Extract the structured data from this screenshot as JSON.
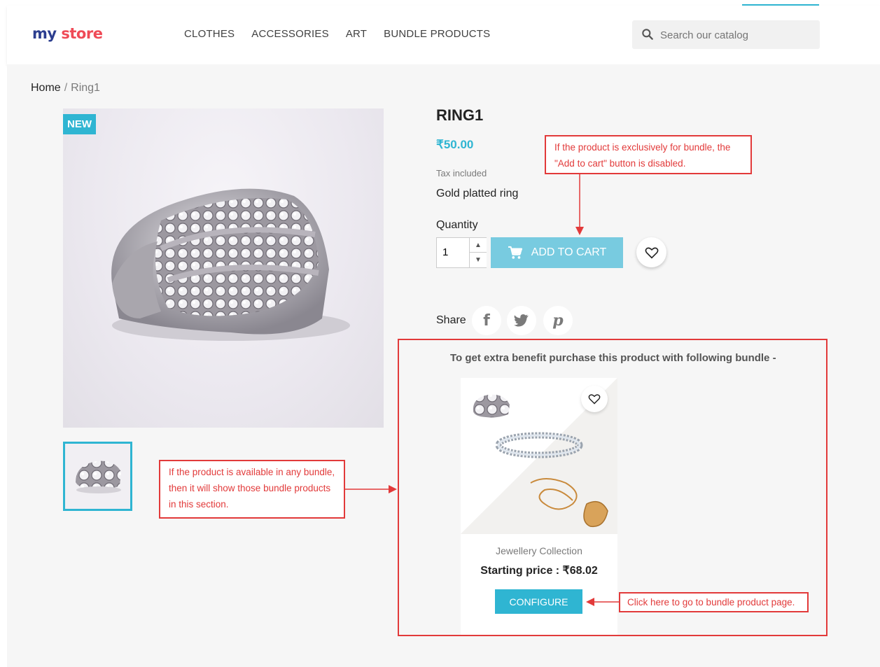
{
  "header": {
    "logo_part1": "my",
    "logo_part2": " store",
    "nav": [
      "CLOTHES",
      "ACCESSORIES",
      "ART",
      "BUNDLE PRODUCTS"
    ],
    "search_placeholder": "Search our catalog"
  },
  "breadcrumb": {
    "home": "Home",
    "separator": "/",
    "current": "Ring1"
  },
  "product": {
    "badge": "NEW",
    "title": "RING1",
    "price": "₹50.00",
    "tax_note": "Tax included",
    "description": "Gold platted ring",
    "quantity_label": "Quantity",
    "quantity_value": "1",
    "add_to_cart_label": "ADD TO CART",
    "add_to_cart_disabled": true,
    "share_label": "Share"
  },
  "bundle": {
    "heading": "To get extra benefit purchase this product with following bundle -",
    "name": "Jewellery Collection",
    "price": "Starting price : ₹68.02",
    "configure_label": "CONFIGURE"
  },
  "annotations": {
    "add_to_cart_note": "If the product is exclusively for bundle, the \"Add to cart\" button is disabled.",
    "bundle_section_note": "If the product is available in any bundle, then it will show those bundle products in this section.",
    "configure_note": "Click here to go to bundle product page."
  },
  "colors": {
    "accent": "#2fb5d2",
    "annotation_red": "#e23a3a",
    "logo_blue": "#2c3e8f",
    "logo_red": "#ef4a56"
  }
}
